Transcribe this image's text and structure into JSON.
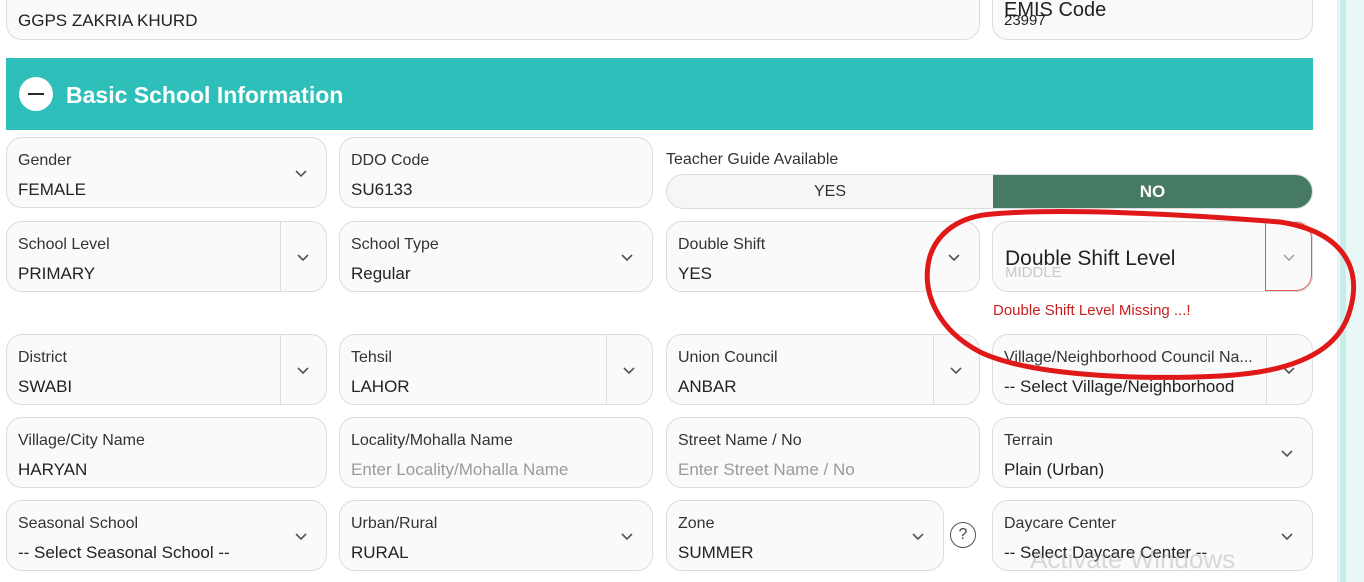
{
  "top": {
    "school_name": "GGPS ZAKRIA KHURD",
    "emis_label": "EMIS Code",
    "emis_value": "23997"
  },
  "section": {
    "title": "Basic School Information"
  },
  "fields": {
    "gender": {
      "label": "Gender",
      "value": "FEMALE"
    },
    "ddo_code": {
      "label": "DDO Code",
      "value": "SU6133"
    },
    "teacher_guide": {
      "label": "Teacher Guide Available",
      "yes": "YES",
      "no": "NO",
      "selected": "NO"
    },
    "school_level": {
      "label": "School Level",
      "value": "PRIMARY"
    },
    "school_type": {
      "label": "School Type",
      "value": "Regular"
    },
    "double_shift": {
      "label": "Double Shift",
      "value": "YES"
    },
    "double_shift_level": {
      "label": "Double Shift Level",
      "value": "MIDDLE",
      "error": "Double Shift Level Missing ...!"
    },
    "district": {
      "label": "District",
      "value": "SWABI"
    },
    "tehsil": {
      "label": "Tehsil",
      "value": "LAHOR"
    },
    "union_council": {
      "label": "Union Council",
      "value": "ANBAR"
    },
    "village_council": {
      "label": "Village/Neighborhood Council Na...",
      "value": "-- Select Village/Neighborhood"
    },
    "village_city": {
      "label": "Village/City Name",
      "value": "HARYAN"
    },
    "locality": {
      "label": "Locality/Mohalla Name",
      "placeholder": "Enter Locality/Mohalla Name"
    },
    "street": {
      "label": "Street Name / No",
      "placeholder": "Enter Street Name / No"
    },
    "terrain": {
      "label": "Terrain",
      "value": "Plain (Urban)"
    },
    "seasonal": {
      "label": "Seasonal School",
      "value": "-- Select Seasonal School --"
    },
    "urban_rural": {
      "label": "Urban/Rural",
      "value": "RURAL"
    },
    "zone": {
      "label": "Zone",
      "value": "SUMMER",
      "help": "?"
    },
    "daycare": {
      "label": "Daycare Center",
      "value": "-- Select Daycare Center --"
    }
  },
  "watermark": "Activate Windows",
  "colors": {
    "section_header": "#2ebfba",
    "toggle_selected": "#477a63",
    "error_text": "#c91d1d",
    "annotation": "#e01818"
  }
}
